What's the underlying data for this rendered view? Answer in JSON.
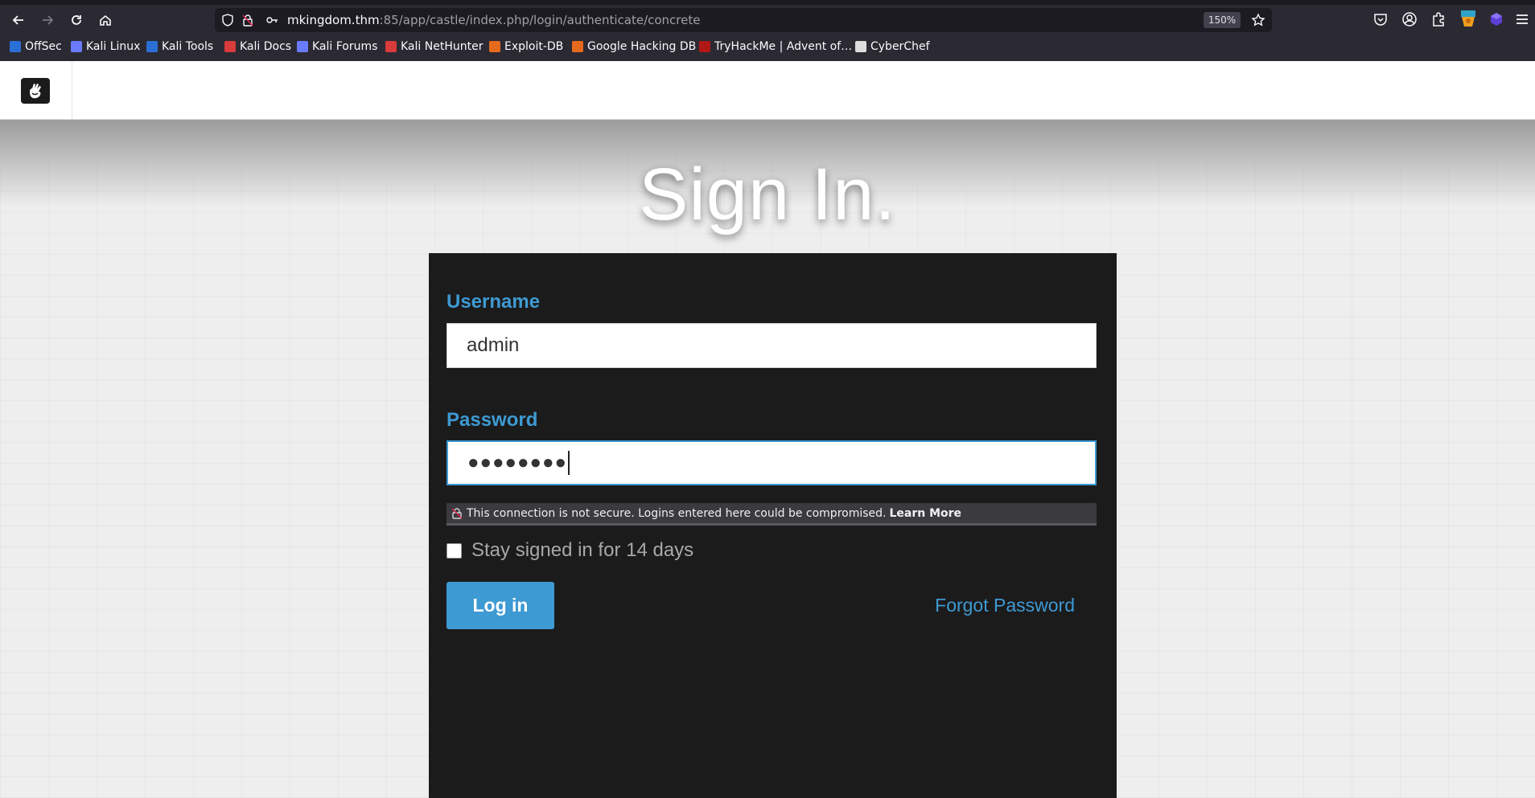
{
  "browser": {
    "url_host": "mkingdom.thm",
    "url_path": ":85/app/castle/index.php/login/authenticate/concrete",
    "zoom": "150%",
    "bookmarks": [
      {
        "label": "OffSec",
        "color": "#2a6fd6"
      },
      {
        "label": "Kali Linux",
        "color": "#6b7bff"
      },
      {
        "label": "Kali Tools",
        "color": "#2a6fd6"
      },
      {
        "label": "Kali Docs",
        "color": "#d93a3a"
      },
      {
        "label": "Kali Forums",
        "color": "#6b7bff"
      },
      {
        "label": "Kali NetHunter",
        "color": "#d93a3a"
      },
      {
        "label": "Exploit-DB",
        "color": "#e66a1e"
      },
      {
        "label": "Google Hacking DB",
        "color": "#e66a1e"
      },
      {
        "label": "TryHackMe | Advent of…",
        "color": "#b01818"
      },
      {
        "label": "CyberChef",
        "color": "#dddddd"
      }
    ]
  },
  "page": {
    "title": "Sign In.",
    "username_label": "Username",
    "username_value": "admin",
    "password_label": "Password",
    "password_mask": "●●●●●●●●",
    "insecure_warning": "This connection is not secure. Logins entered here could be compromised.",
    "learn_more": "Learn More",
    "stay_signed_in": "Stay signed in for 14 days",
    "login_button": "Log in",
    "forgot_password": "Forgot Password"
  },
  "colors": {
    "accent": "#3e9ad2",
    "panel": "#1b1b1c"
  }
}
